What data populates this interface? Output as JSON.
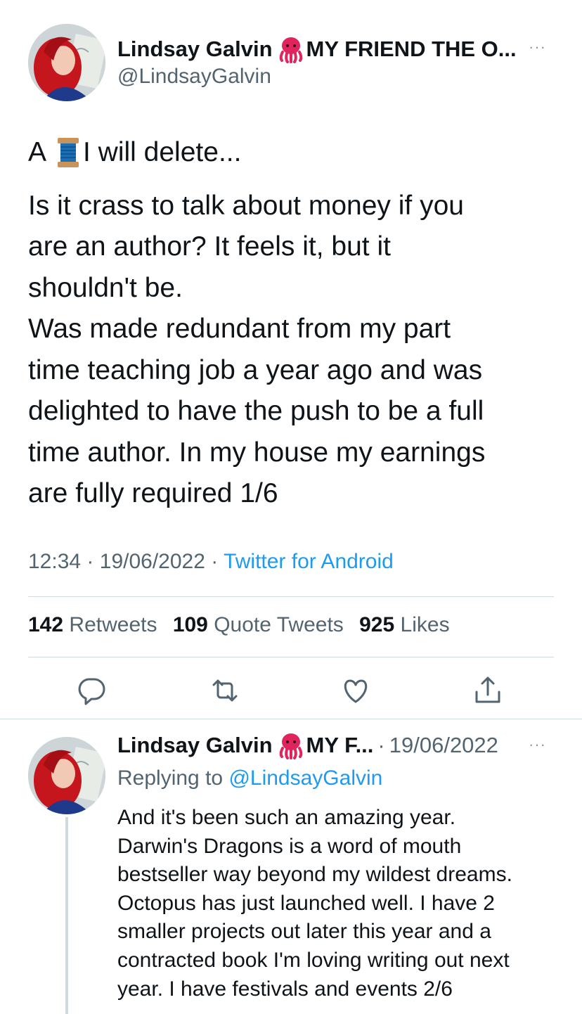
{
  "tweet": {
    "author_name": "Lindsay Galvin",
    "author_name_suffix": "MY FRIEND THE O...",
    "handle": "@LindsayGalvin",
    "thread_prefix": "A",
    "thread_suffix": "I will delete...",
    "body_lines": [
      "Is it crass to talk about money if you",
      "are an author? It feels it, but it",
      "shouldn't be.",
      "Was made redundant from my part",
      "time teaching job a year ago and was",
      "delighted to have the push to be a full",
      "time author. In my house my earnings",
      "are fully required 1/6"
    ],
    "time": "12:34",
    "sep1": "·",
    "date": "19/06/2022",
    "sep2": "·",
    "source": "Twitter for Android",
    "more_label": "···"
  },
  "stats": {
    "retweets_count": "142",
    "retweets_label": "Retweets",
    "quotes_count": "109",
    "quotes_label": "Quote Tweets",
    "likes_count": "925",
    "likes_label": "Likes"
  },
  "actions": [
    "reply-icon",
    "retweet-icon",
    "like-icon",
    "share-icon"
  ],
  "reply": {
    "author_name": "Lindsay Galvin",
    "author_name_suffix": "MY F...",
    "sep": "·",
    "date": "19/06/2022",
    "replying_label": "Replying to",
    "replying_handle": "@LindsayGalvin",
    "more_label": "···",
    "body_lines": [
      "And it's been such an amazing year.",
      "Darwin's Dragons is a word of mouth",
      "bestseller way beyond my wildest dreams.",
      "Octopus has just launched well. I have 2",
      "smaller projects out later this year and a",
      "contracted book I'm loving writing out next",
      "year. I have festivals and events 2/6"
    ]
  },
  "colors": {
    "text": "#0f1419",
    "muted": "#536471",
    "link": "#1d9bf0",
    "divider": "#cfd9de",
    "octopus": "#e0245e"
  }
}
